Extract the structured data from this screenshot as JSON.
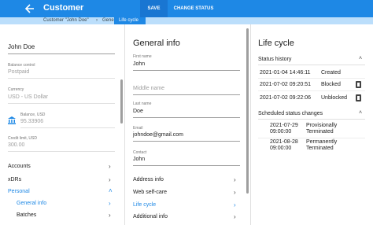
{
  "header": {
    "title": "Customer",
    "save_label": "SAVE",
    "change_status_label": "CHANGE STATUS",
    "color": "#1e88e5"
  },
  "breadcrumb": {
    "items": [
      "Customer \"John Doe\"",
      "General info",
      "Life cycle"
    ]
  },
  "left_panel": {
    "customer_name": "John Doe",
    "balance_control_label": "Balance control",
    "balance_control_value": "Postpaid",
    "currency_label": "Currency",
    "currency_value": "USD - US Dollar",
    "balance_label": "Balance, USD",
    "balance_value": "95.33906",
    "credit_limit_label": "Credit limit, USD",
    "credit_limit_value": "300.00",
    "nav": {
      "accounts": "Accounts",
      "xdrs": "xDRs",
      "personal": "Personal",
      "general_info": "General info",
      "batches": "Batches"
    }
  },
  "general_info": {
    "title": "General info",
    "first_name_label": "First name",
    "first_name_value": "John",
    "middle_name_placeholder": "Middle name",
    "last_name_label": "Last name",
    "last_name_value": "Doe",
    "email_label": "Email",
    "email_value": "johndoe@gmail.com",
    "contact_label": "Contact",
    "contact_value": "John",
    "links": {
      "address_info": "Address info",
      "web_self_care": "Web self-care",
      "life_cycle": "Life cycle",
      "additional_info": "Additional info"
    }
  },
  "life_cycle": {
    "title": "Life cycle",
    "status_history_label": "Status history",
    "status_history": [
      {
        "date": "2021-01-04 14:46:11",
        "status": "Created"
      },
      {
        "date": "2021-07-02 09:20:51",
        "status": "Blocked"
      },
      {
        "date": "2021-07-02 09:22:06",
        "status": "Unblocked"
      }
    ],
    "scheduled_label": "Scheduled status changes",
    "scheduled": [
      {
        "date_line1": "2021-07-29",
        "date_line2": "09:00:00",
        "status_line1": "Provisionally",
        "status_line2": "Terminated"
      },
      {
        "date_line1": "2021-08-28",
        "date_line2": "09:00:00",
        "status_line1": "Permanently",
        "status_line2": "Terminated"
      }
    ]
  }
}
